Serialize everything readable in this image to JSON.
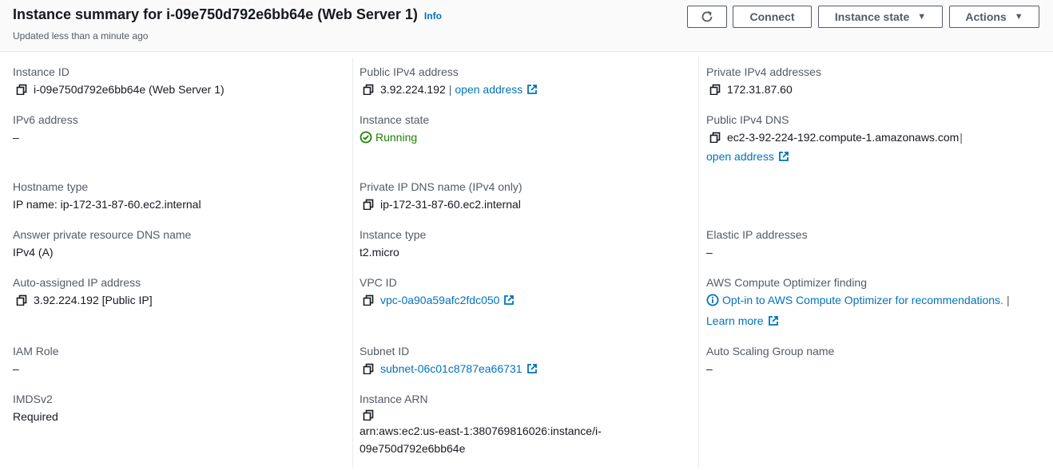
{
  "header": {
    "title": "Instance summary for i-09e750d792e6bb64e (Web Server 1)",
    "info_link": "Info",
    "subtitle": "Updated less than a minute ago",
    "buttons": {
      "refresh_icon": "refresh-icon",
      "connect": "Connect",
      "instance_state": "Instance state",
      "actions": "Actions"
    }
  },
  "fields": {
    "instance_id": {
      "label": "Instance ID",
      "value": "i-09e750d792e6bb64e (Web Server 1)"
    },
    "ipv6_address": {
      "label": "IPv6 address",
      "value": "–"
    },
    "hostname_type": {
      "label": "Hostname type",
      "value": "IP name: ip-172-31-87-60.ec2.internal"
    },
    "answer_private_dns": {
      "label": "Answer private resource DNS name",
      "value": "IPv4 (A)"
    },
    "auto_assigned_ip": {
      "label": "Auto-assigned IP address",
      "value": "3.92.224.192 [Public IP]"
    },
    "iam_role": {
      "label": "IAM Role",
      "value": "–"
    },
    "imdsv2": {
      "label": "IMDSv2",
      "value": "Required"
    },
    "public_ipv4": {
      "label": "Public IPv4 address",
      "value": "3.92.224.192",
      "separator": "|",
      "link": "open address"
    },
    "instance_state": {
      "label": "Instance state",
      "value": "Running",
      "color": "#1d8102"
    },
    "private_ip_dns": {
      "label": "Private IP DNS name (IPv4 only)",
      "value": "ip-172-31-87-60.ec2.internal"
    },
    "instance_type": {
      "label": "Instance type",
      "value": "t2.micro"
    },
    "vpc_id": {
      "label": "VPC ID",
      "value": "vpc-0a90a59afc2fdc050"
    },
    "subnet_id": {
      "label": "Subnet ID",
      "value": "subnet-06c01c8787ea66731"
    },
    "instance_arn": {
      "label": "Instance ARN",
      "value_line1": "arn:aws:ec2:us-east-1:380769816026:instance/i-",
      "value_line2": "09e750d792e6bb64e"
    },
    "private_ipv4": {
      "label": "Private IPv4 addresses",
      "value": "172.31.87.60"
    },
    "public_ipv4_dns": {
      "label": "Public IPv4 DNS",
      "value": "ec2-3-92-224-192.compute-1.amazonaws.com",
      "separator": "|",
      "link": "open address"
    },
    "elastic_ip": {
      "label": "Elastic IP addresses",
      "value": "–"
    },
    "compute_optimizer": {
      "label": "AWS Compute Optimizer finding",
      "link": "Opt-in to AWS Compute Optimizer for recommendations.",
      "separator": "|",
      "learn_more": "Learn more"
    },
    "auto_scaling_group": {
      "label": "Auto Scaling Group name",
      "value": "–"
    }
  },
  "colors": {
    "link": "#0073bb",
    "success": "#1d8102",
    "label": "#545b64",
    "text": "#16191f"
  }
}
